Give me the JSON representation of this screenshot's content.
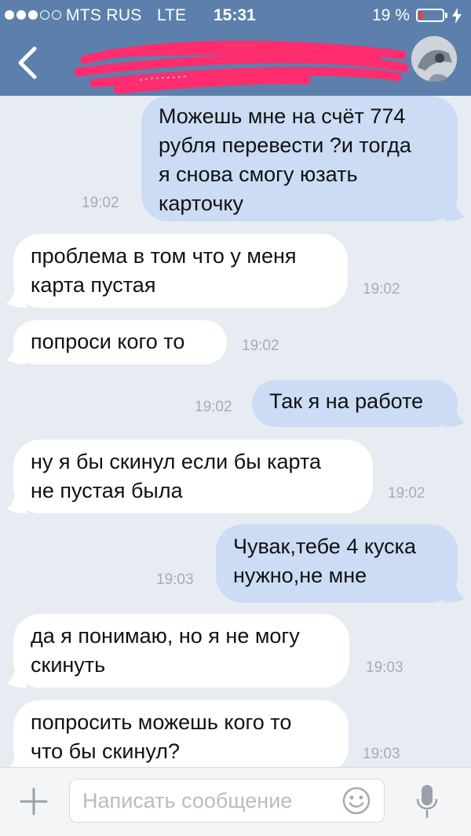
{
  "status_bar": {
    "carrier": "MTS RUS",
    "network": "LTE",
    "time": "15:31",
    "battery_percent_text": "19 %",
    "battery_level": 0.19,
    "signal_bars_filled": 3,
    "signal_bars_total": 5
  },
  "nav": {
    "back_icon": "chevron-left-icon",
    "contact_name_redacted": true
  },
  "messages": [
    {
      "direction": "out",
      "text": "Можешь мне на счёт 774\nрубля перевести ?и тогда\nя снова смогу юзать\nкарточку",
      "time": "19:02"
    },
    {
      "direction": "in",
      "text": "проблема в том что у меня\nкарта пустая",
      "time": "19:02"
    },
    {
      "direction": "in",
      "text": "попроси кого то",
      "time": "19:02"
    },
    {
      "direction": "out",
      "text": "Так я на работе",
      "time": "19:02"
    },
    {
      "direction": "in",
      "text": "ну я бы скинул если бы карта\nне пустая была",
      "time": "19:02"
    },
    {
      "direction": "out",
      "text": "Чувак,тебе 4 куска\nнужно,не мне",
      "time": "19:03"
    },
    {
      "direction": "in",
      "text": "да я понимаю, но я не могу\nскинуть",
      "time": "19:03"
    },
    {
      "direction": "in",
      "text": "попросить можешь кого то\nчто бы скинул?",
      "time": "19:03"
    }
  ],
  "composer": {
    "placeholder": "Написать сообщение",
    "attach_icon": "plus-icon",
    "emoji_icon": "smile-icon",
    "voice_icon": "microphone-icon"
  },
  "colors": {
    "header": "#5c80ab",
    "background": "#e7ecf2",
    "incoming_bubble": "#ffffff",
    "outgoing_bubble": "#cbdcf4",
    "timestamp": "#a5acb6",
    "redaction": "#ff2c6e",
    "battery_low": "#ff3b30"
  }
}
